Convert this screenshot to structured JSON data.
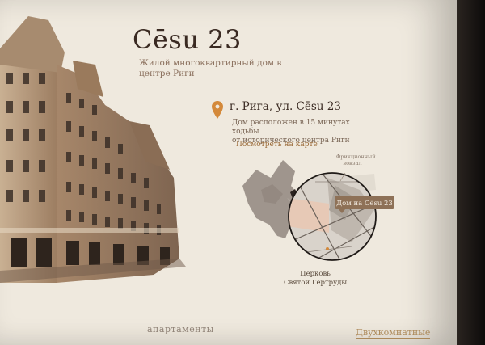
{
  "header": {
    "title": "Cēsu 23",
    "subtitle_line1": "Жилой многоквартирный дом в",
    "subtitle_line2": "центре Риги"
  },
  "location": {
    "address": "г. Рига, ул. Cēsu 23",
    "description_line1": "Дом расположен в 15 минутах ходьбы",
    "description_line2": "от исторического центра Риги",
    "map_link": "Посмотреть на карте"
  },
  "map": {
    "marker_label": "Дом на Cēsu 23",
    "station_label_line1": "Фрикционный",
    "station_label_line2": "вокзал",
    "church_label_line1": "Церковь",
    "church_label_line2": "Святой Гертруды"
  },
  "tabs": {
    "left": "апартаменты",
    "right": "Двухкомнатные"
  },
  "colors": {
    "accent": "#d4893a",
    "background": "#efe9de",
    "text": "#3a2a22",
    "marker_bg": "#8e7157"
  }
}
